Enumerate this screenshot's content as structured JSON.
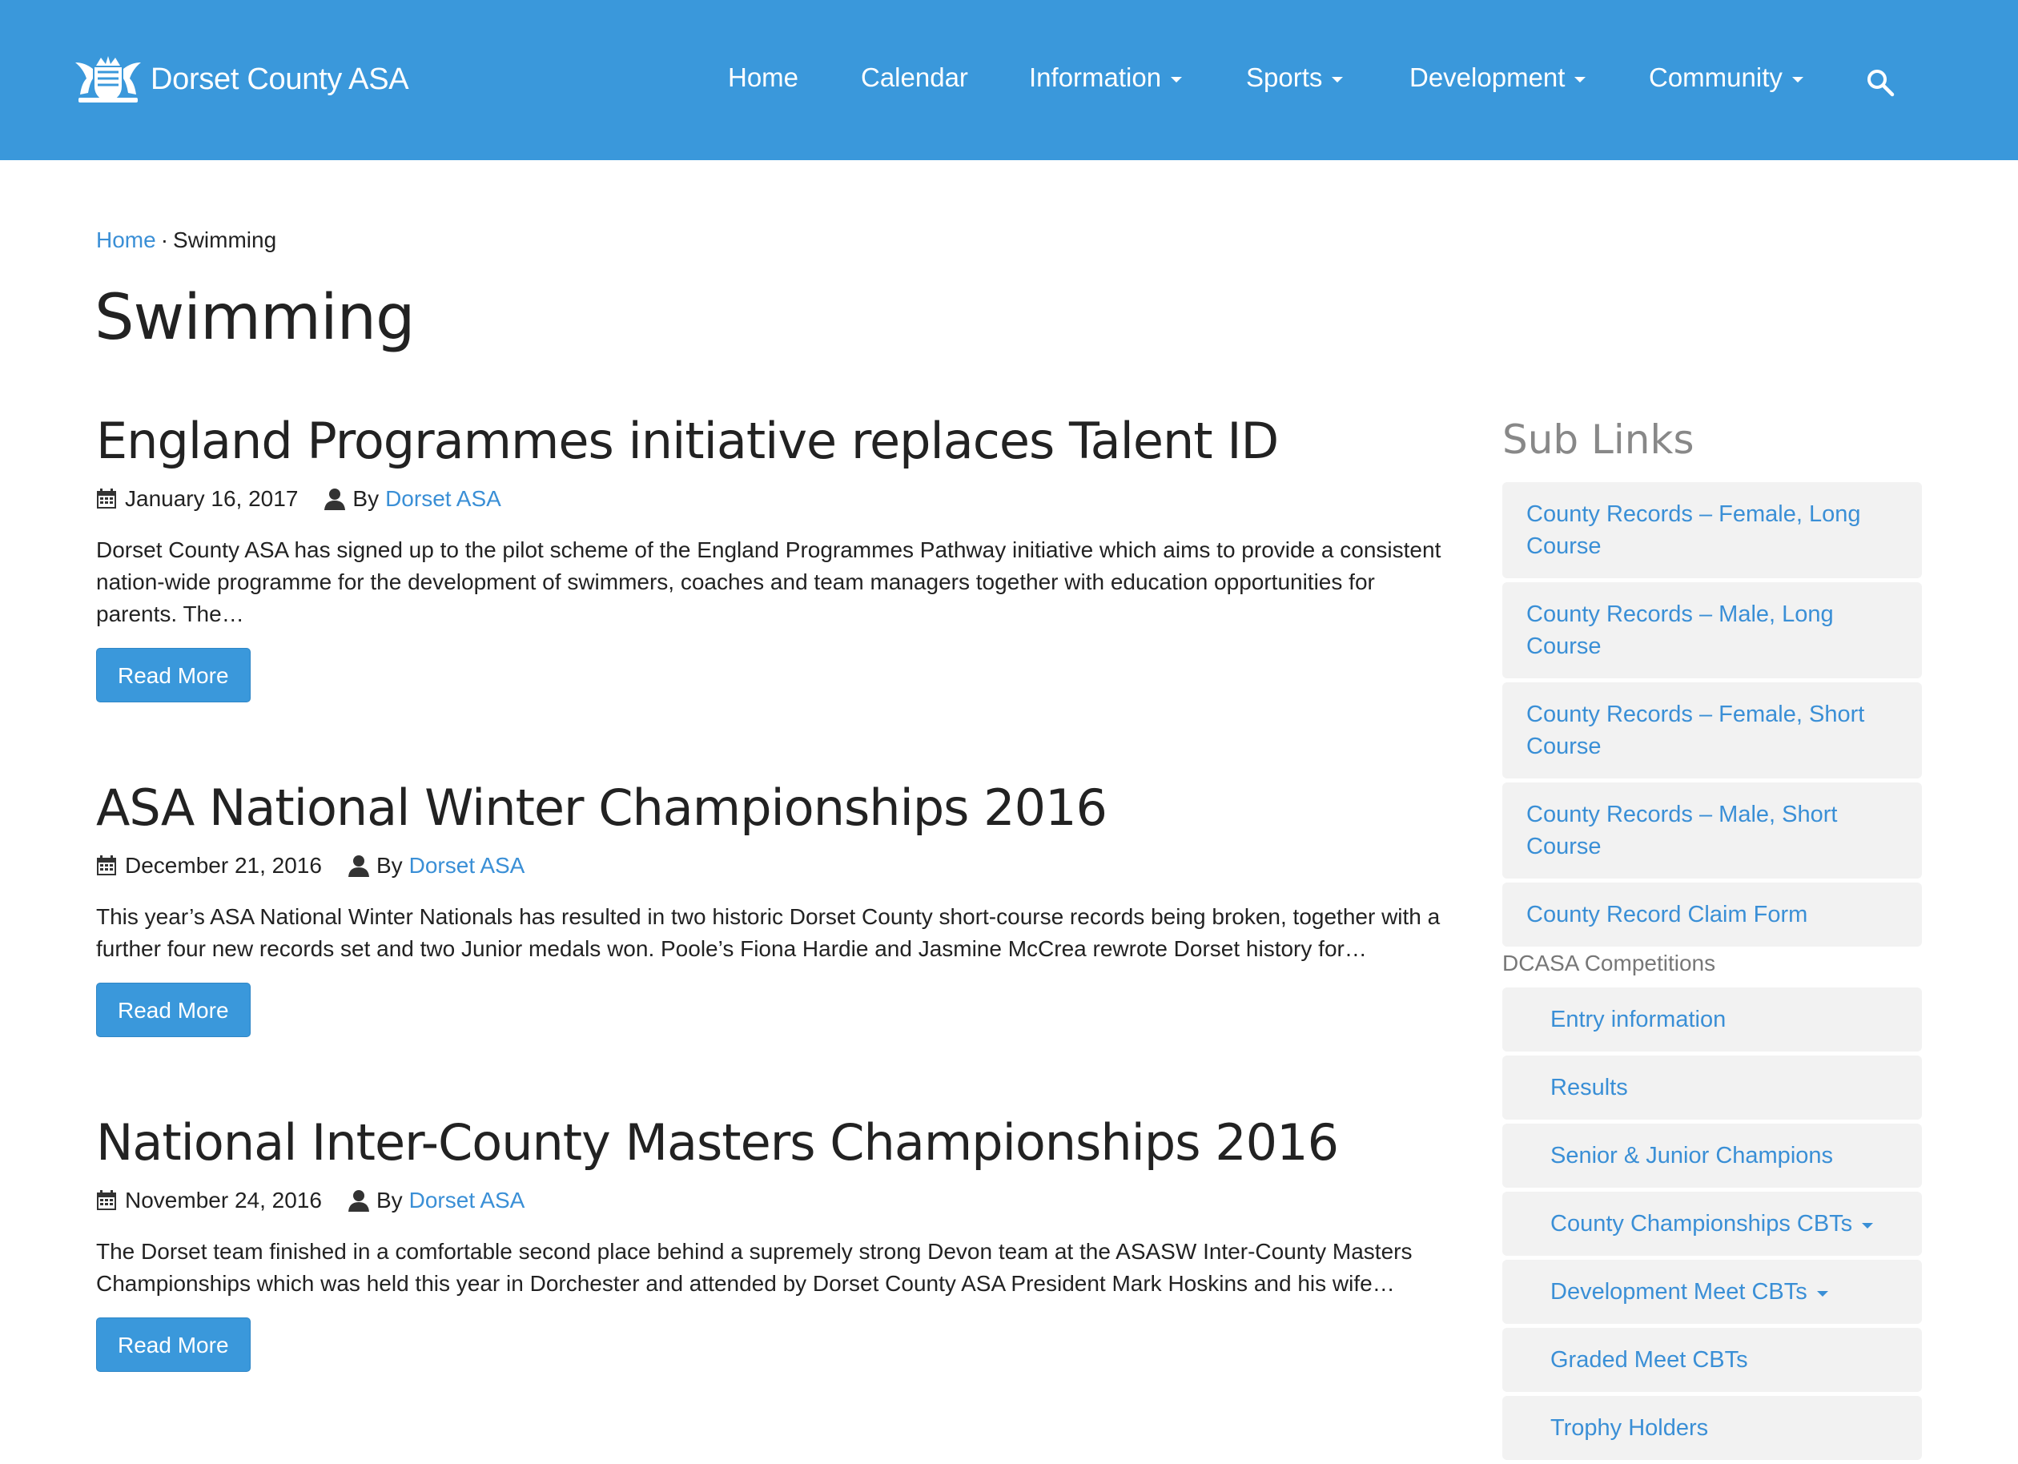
{
  "navbar": {
    "brand": "Dorset County ASA",
    "brand_icon": "crest-icon",
    "items": [
      {
        "label": "Home",
        "dropdown": false
      },
      {
        "label": "Calendar",
        "dropdown": false
      },
      {
        "label": "Information",
        "dropdown": true
      },
      {
        "label": "Sports",
        "dropdown": true
      },
      {
        "label": "Development",
        "dropdown": true
      },
      {
        "label": "Community",
        "dropdown": true
      }
    ],
    "search_icon": "search-icon",
    "bg_color": "#3a98db"
  },
  "breadcrumb": {
    "home": "Home",
    "separator": "·",
    "current": "Swimming"
  },
  "page_title": "Swimming",
  "posts": [
    {
      "title": "England Programmes initiative replaces Talent ID",
      "date": "January 16, 2017",
      "by": "By",
      "author": "Dorset ASA",
      "excerpt": "Dorset County ASA has signed up to the pilot scheme of the England Programmes Pathway initiative which aims to provide a consistent nation-wide programme for the development of swimmers, coaches and team managers together with education opportunities for parents. The…",
      "button": "Read More"
    },
    {
      "title": "ASA National Winter Championships 2016",
      "date": "December 21, 2016",
      "by": "By",
      "author": "Dorset ASA",
      "excerpt": "This year’s ASA National Winter Nationals has resulted in two historic Dorset County short-course records being broken, together with a further four new records set and two Junior medals won. Poole’s Fiona Hardie and Jasmine McCrea rewrote Dorset history for…",
      "button": "Read More"
    },
    {
      "title": "National Inter-County Masters Championships 2016",
      "date": "November 24, 2016",
      "by": "By",
      "author": "Dorset ASA",
      "excerpt": "The Dorset team finished in a comfortable second place behind a supremely strong Devon team at the ASASW Inter-County Masters Championships which was held this year in Dorchester and attended by Dorset County ASA President Mark Hoskins and his wife…",
      "button": "Read More"
    }
  ],
  "sidebar": {
    "title": "Sub Links",
    "links": [
      "County Records – Female, Long Course",
      "County Records – Male, Long Course",
      "County Records – Female, Short Course",
      "County Records – Male, Short Course",
      "County Record Claim Form"
    ],
    "section_heading": "DCASA Competitions",
    "sub_links": [
      {
        "label": "Entry information",
        "dropdown": false
      },
      {
        "label": "Results",
        "dropdown": false
      },
      {
        "label": "Senior & Junior Champions",
        "dropdown": false
      },
      {
        "label": "County Championships CBTs",
        "dropdown": true
      },
      {
        "label": "Development Meet CBTs",
        "dropdown": true
      },
      {
        "label": "Graded Meet CBTs",
        "dropdown": false
      },
      {
        "label": "Trophy Holders",
        "dropdown": false
      }
    ]
  }
}
